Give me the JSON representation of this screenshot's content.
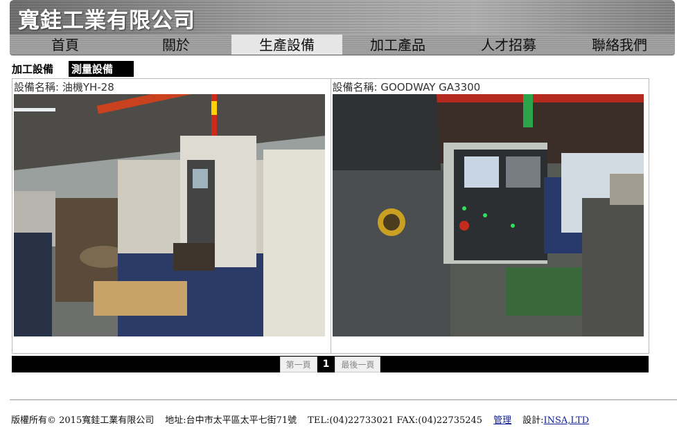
{
  "header": {
    "company": "寬銈工業有限公司"
  },
  "nav": {
    "items": [
      "首頁",
      "關於",
      "生產設備",
      "加工產品",
      "人才招募",
      "聯絡我們"
    ],
    "active": "生產設備"
  },
  "subnav": {
    "label": "加工設備",
    "active_tab": "測量設備"
  },
  "gallery": {
    "items": [
      {
        "caption": "設備名稱: 油機YH-28"
      },
      {
        "caption": "設備名稱: GOODWAY GA3300"
      }
    ]
  },
  "pager": {
    "first": "第一頁",
    "current": "1",
    "last": "最後一頁"
  },
  "footer": {
    "copyright": "版權所有© 2015寬銈工業有限公司",
    "address": "地址:台中市太平區太平七街71號",
    "tel": "TEL:(04)22733021 FAX:(04)22735245",
    "admin": "管理",
    "design_label": "設計:",
    "design_link": "INSA,LTD"
  }
}
